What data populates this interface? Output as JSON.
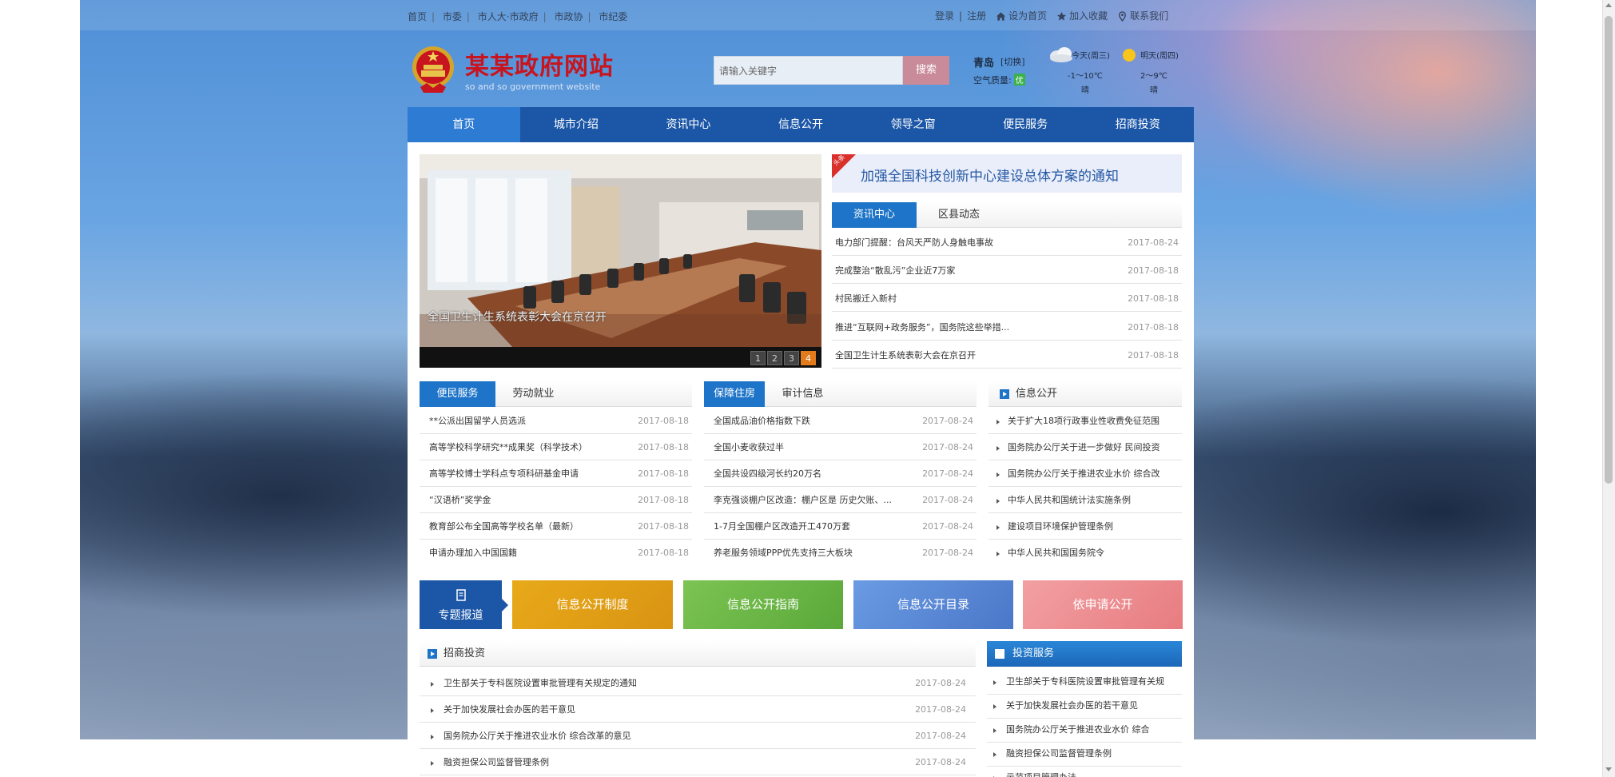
{
  "topbar": {
    "links": [
      "首页",
      "市委",
      "市人大·市政府",
      "市政协",
      "市纪委"
    ],
    "login": "登录",
    "register": "注册",
    "set_home": "设为首页",
    "favorite": "加入收藏",
    "contact": "联系我们"
  },
  "header": {
    "title": "某某政府网站",
    "subtitle": "so and so government website",
    "search_placeholder": "请输入关键字",
    "search_button": "搜索",
    "city": "青岛",
    "city_switch": "[切换]",
    "air_label": "空气质量:",
    "air_value": "优",
    "weather_today_label": "今天(周三)",
    "weather_today_temp": "-1～10℃",
    "weather_today_desc": "晴",
    "weather_tomorrow_label": "明天(周四)",
    "weather_tomorrow_temp": "2～9℃",
    "weather_tomorrow_desc": "晴"
  },
  "nav": [
    "首页",
    "城市介绍",
    "资讯中心",
    "信息公开",
    "领导之窗",
    "便民服务",
    "招商投资"
  ],
  "slideshow": {
    "caption": "全国卫生计生系统表彰大会在京召开",
    "pages": [
      "1",
      "2",
      "3",
      "4"
    ],
    "active_page": "4"
  },
  "headline": {
    "tag": "头条",
    "text": "加强全国科技创新中心建设总体方案的通知"
  },
  "news": {
    "tabs": [
      "资讯中心",
      "区县动态"
    ],
    "items": [
      {
        "title": "电力部门提醒：台风天严防人身触电事故",
        "date": "2017-08-24"
      },
      {
        "title": "完成整治“散乱污”企业近7万家",
        "date": "2017-08-18"
      },
      {
        "title": "村民搬迁入新村",
        "date": "2017-08-18"
      },
      {
        "title": "推进“互联网+政务服务”，国务院这些举措...",
        "date": "2017-08-18"
      },
      {
        "title": "全国卫生计生系统表彰大会在京召开",
        "date": "2017-08-18"
      }
    ]
  },
  "service": {
    "tabs": [
      "便民服务",
      "劳动就业"
    ],
    "items": [
      {
        "title": "**公派出国留学人员选派",
        "date": "2017-08-18"
      },
      {
        "title": "高等学校科学研究**成果奖（科学技术）",
        "date": "2017-08-18"
      },
      {
        "title": "高等学校博士学科点专项科研基金申请",
        "date": "2017-08-18"
      },
      {
        "title": "“汉语桥”奖学金",
        "date": "2017-08-18"
      },
      {
        "title": "教育部公布全国高等学校名单（最新）",
        "date": "2017-08-18"
      },
      {
        "title": "申请办理加入中国国籍",
        "date": "2017-08-18"
      }
    ]
  },
  "guarantee": {
    "tabs": [
      "保障住房",
      "审计信息"
    ],
    "items": [
      {
        "title": "全国成品油价格指数下跌",
        "date": "2017-08-24"
      },
      {
        "title": "全国小麦收获过半",
        "date": "2017-08-24"
      },
      {
        "title": "全国共设四级河长约20万名",
        "date": "2017-08-24"
      },
      {
        "title": "李克强谈棚户区改造：棚户区是 历史欠账、...",
        "date": "2017-08-24"
      },
      {
        "title": "1-7月全国棚户区改造开工470万套",
        "date": "2017-08-24"
      },
      {
        "title": "养老服务领域PPP优先支持三大板块",
        "date": "2017-08-24"
      }
    ]
  },
  "info_open": {
    "title": "信息公开",
    "items": [
      "关于扩大18项行政事业性收费免征范围",
      "国务院办公厅关于进一步做好 民间投资",
      "国务院办公厅关于推进农业水价 综合改",
      "中华人民共和国统计法实施条例",
      "建设项目环境保护管理条例",
      "中华人民共和国国务院令"
    ]
  },
  "banners": {
    "special": "专题报道",
    "items": [
      "信息公开制度",
      "信息公开指南",
      "信息公开目录",
      "依申请公开"
    ]
  },
  "invest": {
    "title": "招商投资",
    "items": [
      {
        "title": "卫生部关于专科医院设置审批管理有关规定的通知",
        "date": "2017-08-24"
      },
      {
        "title": "关于加快发展社会办医的若干意见",
        "date": "2017-08-24"
      },
      {
        "title": "国务院办公厅关于推进农业水价 综合改革的意见",
        "date": "2017-08-24"
      },
      {
        "title": "融资担保公司监督管理条例",
        "date": "2017-08-24"
      }
    ]
  },
  "invest_service": {
    "title": "投资服务",
    "items": [
      "卫生部关于专科医院设置审批管理有关规",
      "关于加快发展社会办医的若干意见",
      "国务院办公厅关于推进农业水价 综合",
      "融资担保公司监督管理条例",
      "示范项目管理办法"
    ]
  }
}
